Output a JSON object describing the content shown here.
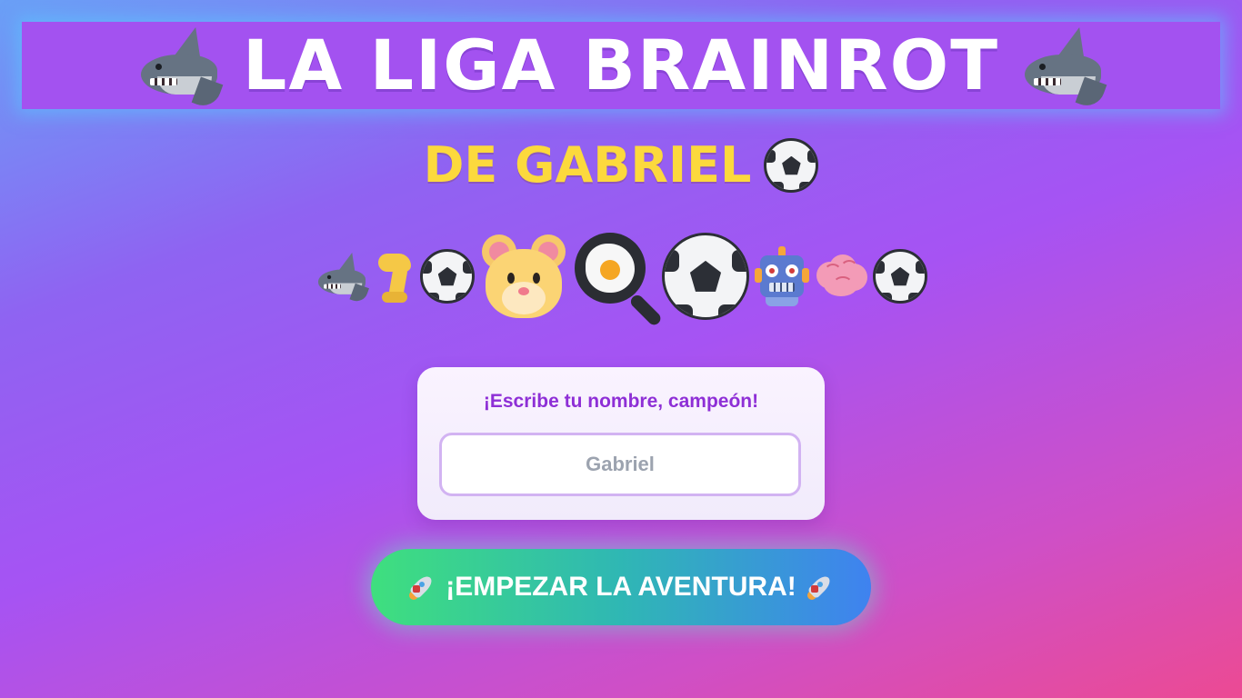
{
  "header": {
    "title": "LA LIGA BRAINROT",
    "left_icon": "shark-emoji",
    "right_icon": "shark-emoji"
  },
  "subtitle": {
    "text": "DE GABRIEL",
    "icon": "soccer-ball-emoji"
  },
  "emoji_row": [
    "shark",
    "leg",
    "soccer-ball",
    "hamster",
    "frying-pan-egg",
    "soccer-ball",
    "robot",
    "brain",
    "soccer-ball"
  ],
  "name_card": {
    "label": "¡Escribe tu nombre, campeón!",
    "input_placeholder": "Gabriel",
    "input_value": ""
  },
  "start_button": {
    "label": "¡EMPEZAR LA AVENTURA!",
    "icon": "rocket-emoji"
  },
  "colors": {
    "title": "#ffffff",
    "subtitle": "#fcd93d",
    "card_label": "#8e2fd6",
    "button_gradient_start": "#3fdf7e",
    "button_gradient_end": "#3f82f0"
  }
}
